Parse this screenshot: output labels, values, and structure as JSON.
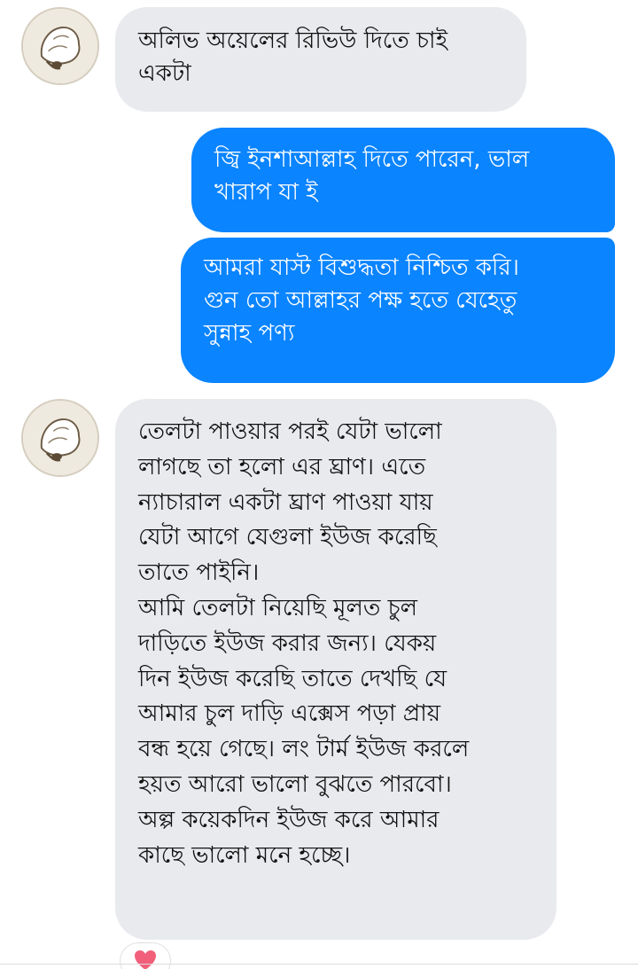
{
  "messages": [
    {
      "sender": "other",
      "text": "অলিভ অয়েলের রিভিউ দিতে চাই\nএকটা"
    },
    {
      "sender": "me",
      "text": "জ্বি ইনশাআল্লাহ দিতে পারেন, ভাল\nখারাপ যা ই"
    },
    {
      "sender": "me",
      "text": "আমরা যাস্ট বিশুদ্ধতা নিশ্চিত করি।\nগুন তো আল্লাহর পক্ষ হতে যেহেতু\nসুন্নাহ পণ্য"
    },
    {
      "sender": "other",
      "text": "তেলটা পাওয়ার পরই যেটা ভালো\nলাগছে তা হলো এর ঘ্রাণ। এতে\nন্যাচারাল একটা ঘ্রাণ পাওয়া যায়\nযেটা আগে যেগুলা ইউজ করেছি\nতাতে পাইনি।\nআমি তেলটা নিয়েছি মূলত চুল\nদাড়িতে ইউজ করার জন্য। যেকয়\nদিন ইউজ করেছি তাতে দেখছি যে\nআমার চুল দাড়ি এক্সেস পড়া প্রায়\nবন্ধ হয়ে গেছে। লং টার্ম ইউজ করলে\nহয়ত আরো ভালো বুঝতে পারবো।\nঅল্প কয়েকদিন ইউজ করে আমার\nকাছে ভালো মনে হচ্ছে।"
    }
  ],
  "reaction": {
    "icon": "heart-icon"
  },
  "colors": {
    "outgoing_bubble": "#0a84ff",
    "incoming_bubble": "#e9eaee",
    "reaction_heart": "#f25f7a"
  }
}
